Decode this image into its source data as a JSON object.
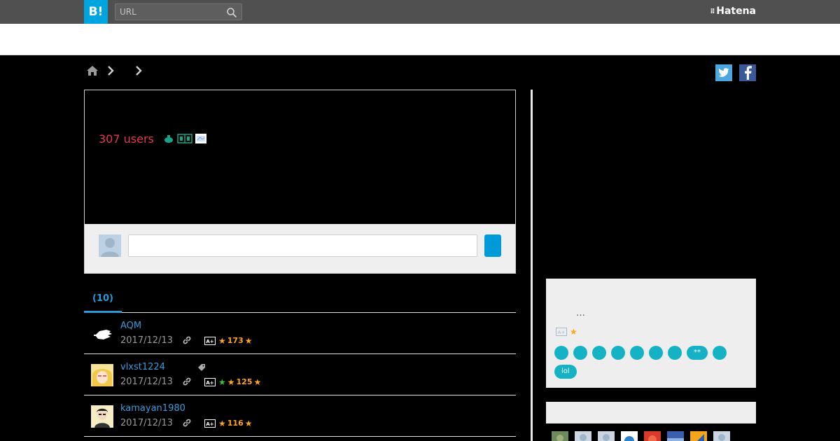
{
  "header": {
    "logo_text": "B!",
    "url_placeholder": "URL",
    "brand": "Hatena"
  },
  "entry": {
    "users_count": "307 users"
  },
  "tabs": [
    {
      "label": "(10)",
      "active": true
    }
  ],
  "bookmarks": [
    {
      "user": "AQM",
      "date": "2017/12/13",
      "star_count": "173",
      "has_tag": false,
      "extra_green_star": false
    },
    {
      "user": "vlxst1224",
      "date": "2017/12/13",
      "star_count": "125",
      "has_tag": true,
      "extra_green_star": true
    },
    {
      "user": "kamayan1980",
      "date": "2017/12/13",
      "star_count": "116",
      "has_tag": false,
      "extra_green_star": false
    }
  ],
  "sidebar": {
    "ellipsis": "…",
    "pill_labels": [
      "",
      "",
      "",
      "",
      "",
      "",
      "",
      "**",
      "",
      "lol"
    ]
  },
  "colors": {
    "brand_blue": "#00a4de",
    "users_red": "#e33a4e",
    "link_blue": "#3a9cd8",
    "tag_pill": "#14b2c4",
    "star_orange": "#ffa41c"
  }
}
